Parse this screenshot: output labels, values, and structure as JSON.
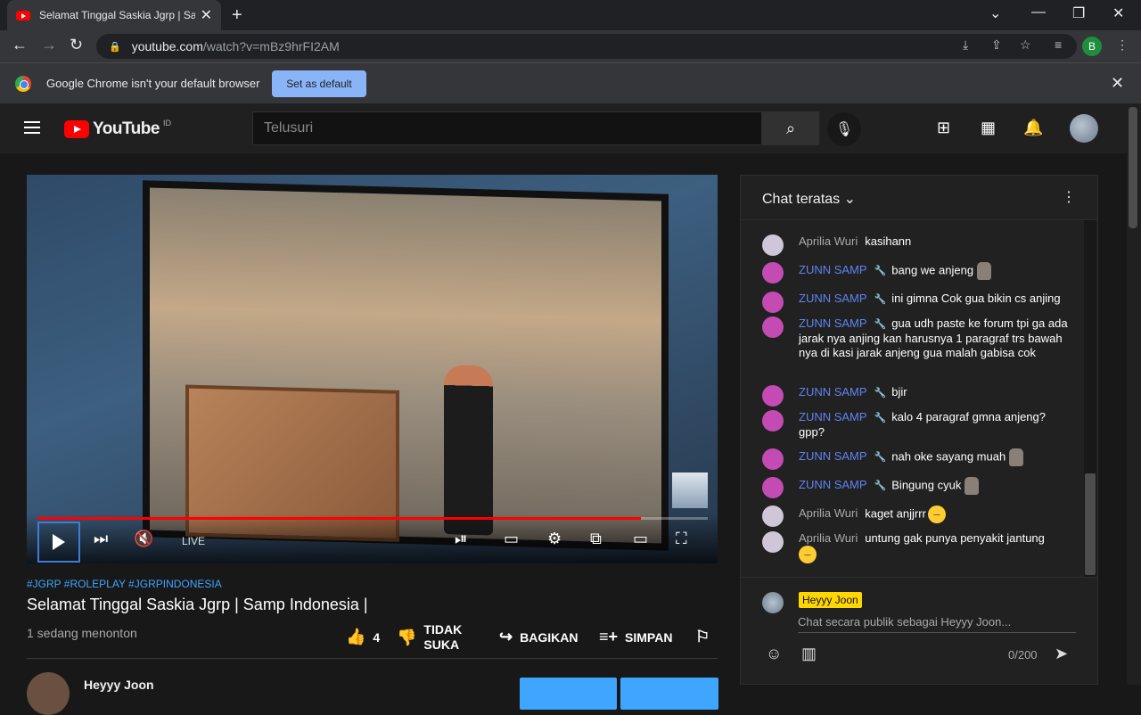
{
  "browser": {
    "tab_title": "Selamat Tinggal Saskia Jgrp | Samp Indonesia |",
    "url_host": "youtube.com",
    "url_path": "/watch?v=mBz9hrFI2AM",
    "profile_initial": "B"
  },
  "infobar": {
    "message": "Google Chrome isn't your default browser",
    "button_label": "Set as default"
  },
  "youtube": {
    "logo_text": "YouTube",
    "country_code": "ID",
    "search_placeholder": "Telusuri"
  },
  "player": {
    "live_label": "LIVE",
    "progress": 0.9
  },
  "video": {
    "tags": "#JGRP #ROLEPLAY #JGRPINDONESIA",
    "title": "Selamat Tinggal Saskia Jgrp | Samp Indonesia |",
    "viewers": "1 sedang menonton",
    "like_count": "4",
    "dislike_label": "TIDAK SUKA",
    "share_label": "BAGIKAN",
    "save_label": "SIMPAN",
    "channel_name": "Heyyy Joon"
  },
  "chat": {
    "header": "Chat teratas",
    "messages": [
      {
        "author": "Aprilia Wuri",
        "text": "kasihann",
        "mod": false
      },
      {
        "author": "ZUNN SAMP",
        "text": "bang we anjeng",
        "mod": true
      },
      {
        "author": "ZUNN SAMP",
        "text": "ini gimna Cok gua bikin cs anjing",
        "mod": true
      },
      {
        "author": "ZUNN SAMP",
        "text": "gua udh paste ke forum tpi ga ada jarak nya anjing kan harusnya 1 paragraf trs bawah nya di kasi jarak anjeng gua malah gabisa cok",
        "mod": true
      },
      {
        "author": "ZUNN SAMP",
        "text": "bjir",
        "mod": true
      },
      {
        "author": "ZUNN SAMP",
        "text": "kalo 4 paragraf gmna anjeng? gpp?",
        "mod": true
      },
      {
        "author": "ZUNN SAMP",
        "text": "nah oke sayang muah",
        "mod": true
      },
      {
        "author": "ZUNN SAMP",
        "text": "Bingung cyuk",
        "mod": true
      },
      {
        "author": "Aprilia Wuri",
        "text": "kaget anjjrrr",
        "mod": false
      },
      {
        "author": "Aprilia Wuri",
        "text": "untung gak punya penyakit jantung",
        "mod": false
      }
    ],
    "my_name": "Heyyy Joon",
    "composer_placeholder": "Chat secara publik sebagai Heyyy Joon...",
    "counter": "0/200"
  },
  "colors": {
    "accent": "#3ea6ff",
    "brand_red": "#ff0000",
    "mod_name": "#5e84f1",
    "my_badge": "#ffd600"
  }
}
